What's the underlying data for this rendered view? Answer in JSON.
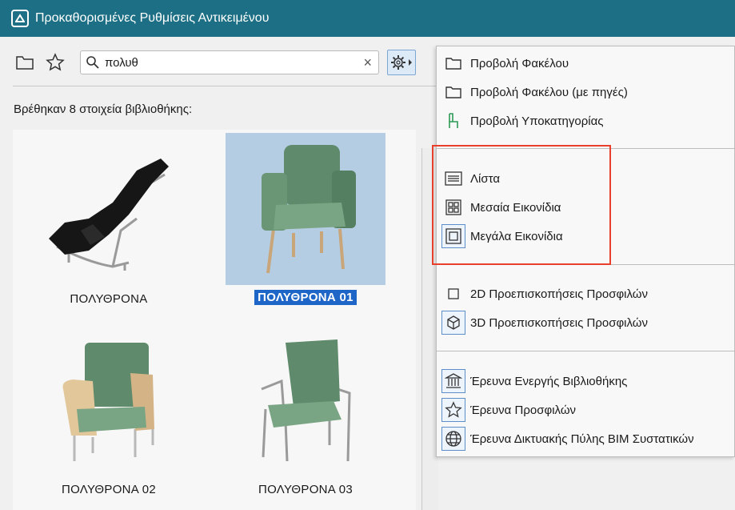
{
  "window": {
    "title": "Προκαθορισμένες Ρυθμίσεις Αντικειμένου",
    "accent_color": "#1c6f84"
  },
  "toolbar": {
    "search_value": "πολυθ",
    "search_placeholder": "",
    "clear_symbol": "×"
  },
  "results": {
    "found_label": "Βρέθηκαν 8 στοιχεία βιβλιοθήκης:",
    "items": [
      {
        "label": "ΠΟΛΥΘΡΟΝΑ",
        "selected": false
      },
      {
        "label": "ΠΟΛΥΘΡΟΝΑ 01",
        "selected": true
      },
      {
        "label": "ΠΟΛΥΘΡΟΝΑ 02",
        "selected": false
      },
      {
        "label": "ΠΟΛΥΘΡΟΝΑ 03",
        "selected": false
      }
    ],
    "selection_color": "#1d66c8"
  },
  "menu": {
    "groups": [
      [
        {
          "label": "Προβολή Φακέλου",
          "icon": "folder-icon"
        },
        {
          "label": "Προβολή Φακέλου (με πηγές)",
          "icon": "folder-sources-icon"
        },
        {
          "label": "Προβολή Υποκατηγορίας",
          "icon": "chair-subcategory-icon"
        }
      ],
      [
        {
          "label": "Λίστα",
          "icon": "list-view-icon"
        },
        {
          "label": "Μεσαία Εικονίδια",
          "icon": "medium-icons-icon"
        },
        {
          "label": "Μεγάλα Εικονίδια",
          "icon": "large-icons-icon"
        }
      ],
      [
        {
          "label": "2D Προεπισκοπήσεις Προσφιλών",
          "icon": "2d-preview-icon"
        },
        {
          "label": "3D Προεπισκοπήσεις Προσφιλών",
          "icon": "3d-preview-icon"
        }
      ],
      [
        {
          "label": "Έρευνα Ενεργής Βιβλιοθήκης",
          "icon": "library-icon"
        },
        {
          "label": "Έρευνα Προσφιλών",
          "icon": "star-icon"
        },
        {
          "label": "Έρευνα Δικτυακής Πύλης BIM Συστατικών",
          "icon": "globe-icon"
        }
      ]
    ],
    "highlight_color": "#e8402f"
  }
}
